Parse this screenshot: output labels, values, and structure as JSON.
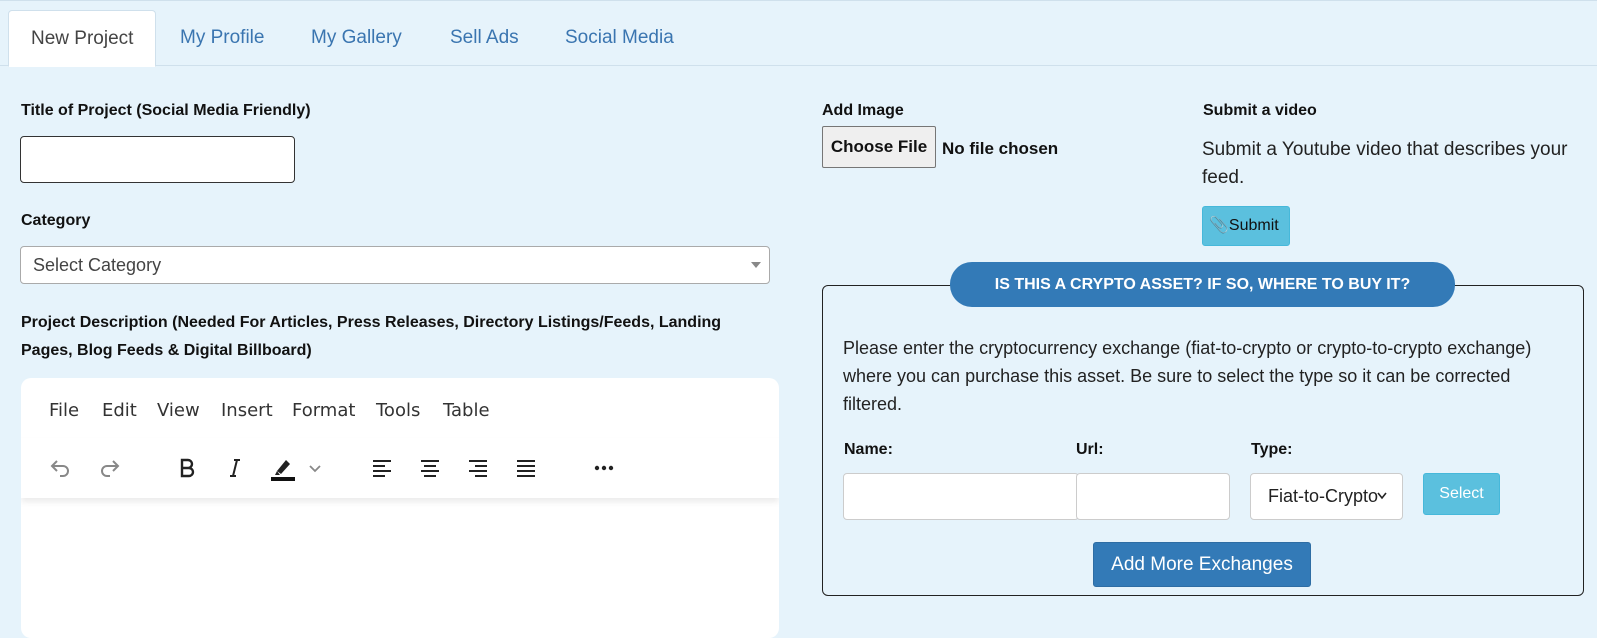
{
  "tabs": [
    {
      "label": "New Project"
    },
    {
      "label": "My Profile"
    },
    {
      "label": "My Gallery"
    },
    {
      "label": "Sell Ads"
    },
    {
      "label": "Social Media"
    }
  ],
  "form": {
    "title_label": "Title of Project (Social Media Friendly)",
    "category_label": "Category",
    "category_value": "Select Category",
    "description_label_line1": "Project Description (Needed For Articles, Press Releases, Directory Listings/Feeds, Landing",
    "description_label_line2": "Pages, Blog Feeds & Digital Billboard)"
  },
  "editor": {
    "menus": [
      "File",
      "Edit",
      "View",
      "Insert",
      "Format",
      "Tools",
      "Table"
    ]
  },
  "image": {
    "label": "Add Image",
    "button": "Choose File",
    "status": "No file chosen"
  },
  "video": {
    "label": "Submit a video",
    "description": "Submit a Youtube video that describes your feed.",
    "button": "Submit"
  },
  "crypto": {
    "banner": "IS THIS A CRYPTO ASSET? IF SO, WHERE TO BUY IT?",
    "description": "Please enter the cryptocurrency exchange (fiat-to-crypto or crypto-to-crypto exchange) where you can purchase this asset. Be sure to select the type so it can be corrected filtered.",
    "name_label": "Name:",
    "url_label": "Url:",
    "type_label": "Type:",
    "type_value": "Fiat-to-Crypto",
    "select_button": "Select",
    "add_button": "Add More Exchanges"
  }
}
